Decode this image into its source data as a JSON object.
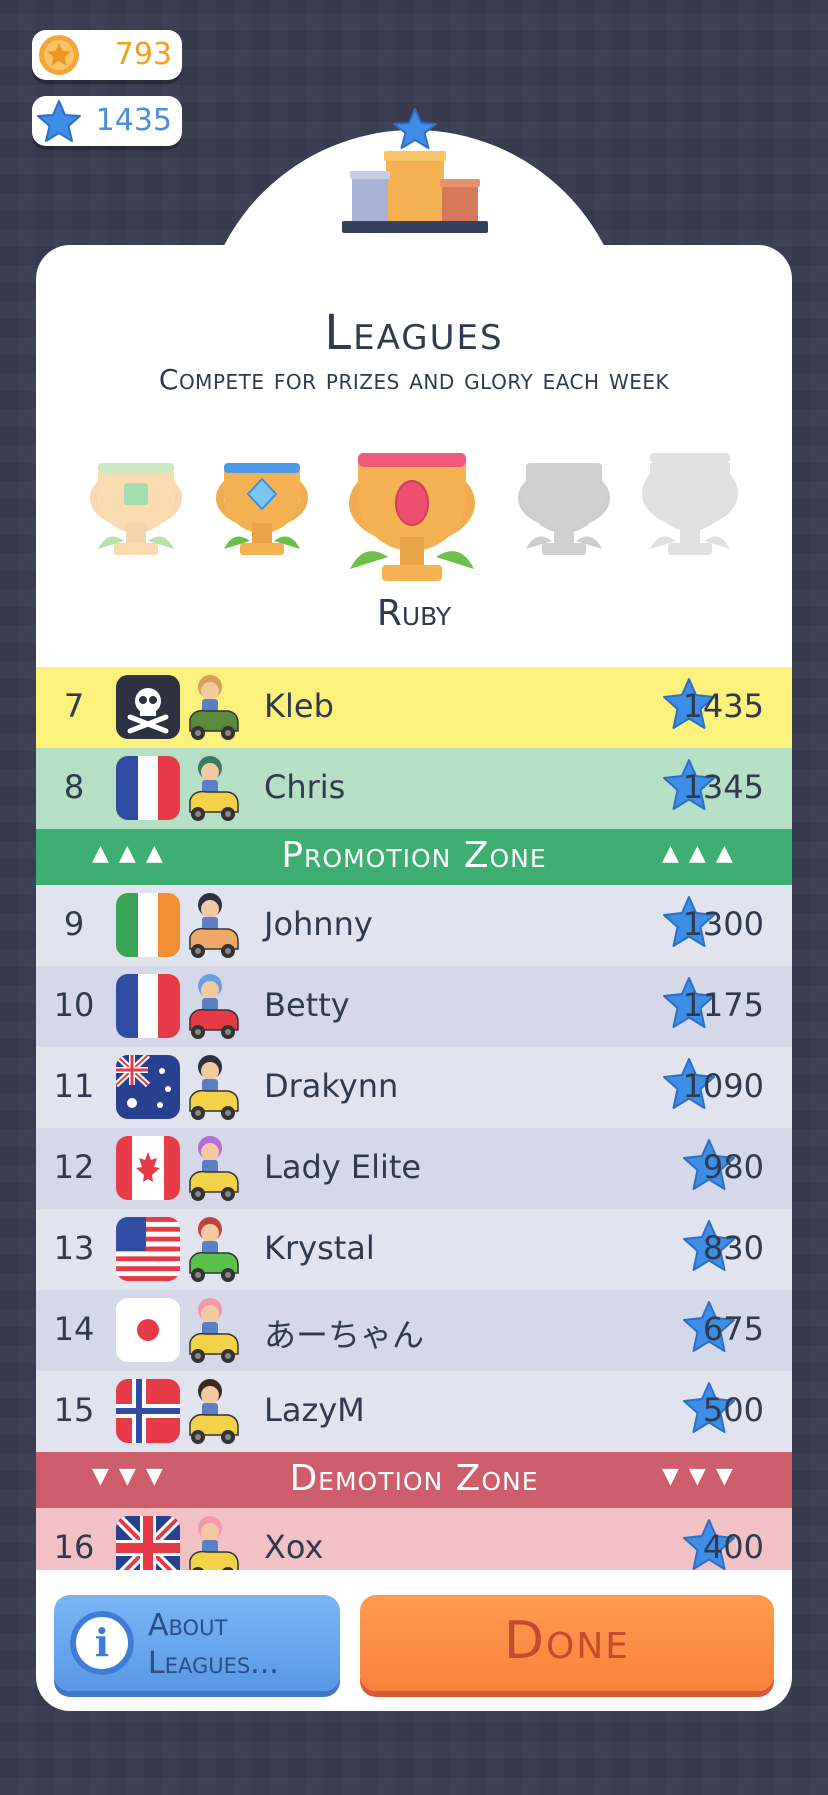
{
  "currency": {
    "coins": "793",
    "stars": "1435",
    "coin_icon": "coin-icon",
    "star_icon": "star-icon"
  },
  "header": {
    "title": "Leagues",
    "subtitle": "Compete for prizes and glory each week",
    "podium_icon": "podium-icon"
  },
  "leagues": {
    "trophies": [
      "emerald",
      "diamond",
      "ruby",
      "locked",
      "locked"
    ],
    "current": "Ruby"
  },
  "leaderboard": {
    "rows": [
      {
        "rank": "7",
        "name": "Kleb",
        "score": "1435",
        "flag": "skull",
        "highlight": "player"
      },
      {
        "rank": "8",
        "name": "Chris",
        "score": "1345",
        "flag": "france",
        "highlight": "promotion"
      },
      {
        "rank": "9",
        "name": "Johnny",
        "score": "1300",
        "flag": "ireland",
        "highlight": "normal"
      },
      {
        "rank": "10",
        "name": "Betty",
        "score": "1175",
        "flag": "france",
        "highlight": "normal"
      },
      {
        "rank": "11",
        "name": "Drakynn",
        "score": "1090",
        "flag": "australia",
        "highlight": "normal"
      },
      {
        "rank": "12",
        "name": "Lady Elite",
        "score": "980",
        "flag": "canada",
        "highlight": "normal"
      },
      {
        "rank": "13",
        "name": "Krystal",
        "score": "830",
        "flag": "usa",
        "highlight": "normal"
      },
      {
        "rank": "14",
        "name": "あーちゃん",
        "score": "675",
        "flag": "japan",
        "highlight": "normal"
      },
      {
        "rank": "15",
        "name": "LazyM",
        "score": "500",
        "flag": "norway",
        "highlight": "normal"
      },
      {
        "rank": "16",
        "name": "Xox",
        "score": "400",
        "flag": "uk",
        "highlight": "demotion"
      }
    ],
    "promotion_zone": "Promotion Zone",
    "demotion_zone": "Demotion Zone",
    "promotion_mark": "▲▲▲",
    "demotion_mark": "▼▼▼"
  },
  "buttons": {
    "about": "About Leagues...",
    "done": "Done"
  },
  "colors": {
    "player_row": "#fbf17c",
    "promotion_row": "#b5e0c6",
    "promotion_band": "#3fae72",
    "row_a": "#e1e3ef",
    "row_b": "#d5d8e8",
    "demotion_band": "#cf5e6c",
    "demotion_row": "#f1c1c6",
    "star_blue": "#3e8de6"
  }
}
